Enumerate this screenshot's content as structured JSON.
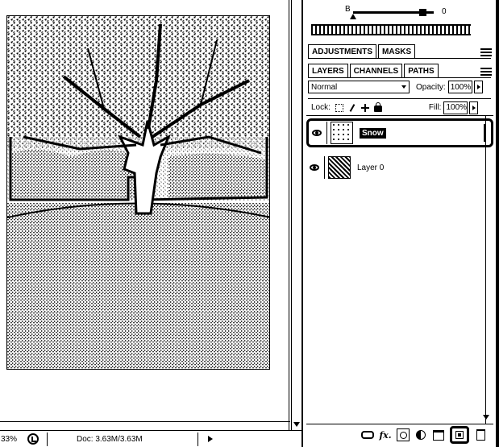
{
  "curves": {
    "channel_label": "B",
    "value": "0"
  },
  "adjust_tabs": [
    {
      "label": "ADJUSTMENTS"
    },
    {
      "label": "MASKS"
    }
  ],
  "layer_tabs": [
    {
      "label": "LAYERS"
    },
    {
      "label": "CHANNELS"
    },
    {
      "label": "PATHS"
    }
  ],
  "blend": {
    "mode": "Normal",
    "opacity_label": "Opacity:",
    "opacity_value": "100%"
  },
  "lock": {
    "label": "Lock:",
    "fill_label": "Fill:",
    "fill_value": "100%"
  },
  "layers": [
    {
      "name": "Snow",
      "selected": true
    },
    {
      "name": "Layer 0",
      "selected": false
    }
  ],
  "status": {
    "zoom": "33%",
    "doc": "Doc: 3.63M/3.63M"
  },
  "footer_icons": [
    "link-layers-icon",
    "fx-icon",
    "mask-icon",
    "adjustment-icon",
    "group-icon",
    "new-layer-icon",
    "trash-icon"
  ],
  "colors": {
    "foreground": "#000000",
    "background": "#ffffff"
  }
}
